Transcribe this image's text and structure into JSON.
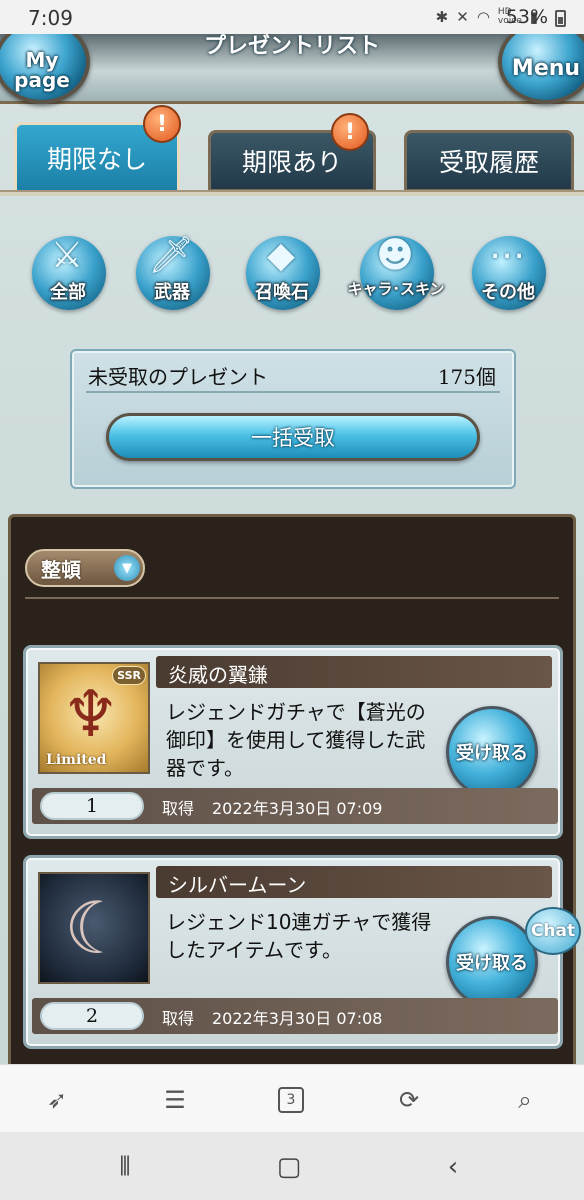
{
  "status_bar": {
    "time": "7:09",
    "icons": [
      "bluetooth-icon",
      "mute-icon",
      "wifi-icon",
      "hd-voice-icon",
      "signal-icon"
    ],
    "battery": "53%"
  },
  "header": {
    "title": "プレゼントリスト",
    "mypage_label": "My\npage",
    "menu_label": "Menu"
  },
  "tabs": [
    {
      "label": "期限なし",
      "active": true,
      "notice": true
    },
    {
      "label": "期限あり",
      "active": false,
      "notice": true
    },
    {
      "label": "受取履歴",
      "active": false,
      "notice": false
    }
  ],
  "notice_glyph": "!",
  "categories": [
    {
      "label": "全部",
      "icon": "all-items-icon"
    },
    {
      "label": "武器",
      "icon": "sword-icon"
    },
    {
      "label": "召喚石",
      "icon": "crystal-icon"
    },
    {
      "label": "キャラ･スキン",
      "icon": "character-icon"
    },
    {
      "label": "その他",
      "icon": "more-icon"
    }
  ],
  "unreceived": {
    "label": "未受取のプレゼント",
    "count": "175個",
    "bulk_button": "一括受取"
  },
  "sort": {
    "label": "整頓"
  },
  "presents": [
    {
      "name": "炎威の翼鎌",
      "description": "レジェンドガチャで【蒼光の御印】を使用して獲得した武器です。",
      "button": "受け取る",
      "quantity": "1",
      "obtained_label": "取得",
      "obtained_date": "2022年3月30日 07:09",
      "rarity": "SSR",
      "badge": "Limited",
      "icon": "wing-scythe-icon"
    },
    {
      "name": "シルバームーン",
      "description": "レジェンド10連ガチャで獲得したアイテムです。",
      "button": "受け取る",
      "quantity": "2",
      "obtained_label": "取得",
      "obtained_date": "2022年3月30日 07:08",
      "icon": "crescent-moon-icon"
    }
  ],
  "chat_label": "Chat",
  "browser_toolbar": {
    "tab_count": "3",
    "icons": [
      "rocket-icon",
      "menu-icon",
      "tabs-icon",
      "reload-icon",
      "search-icon"
    ]
  },
  "nav_bar": {
    "icons": [
      "recent-apps-icon",
      "home-icon",
      "back-icon"
    ]
  }
}
